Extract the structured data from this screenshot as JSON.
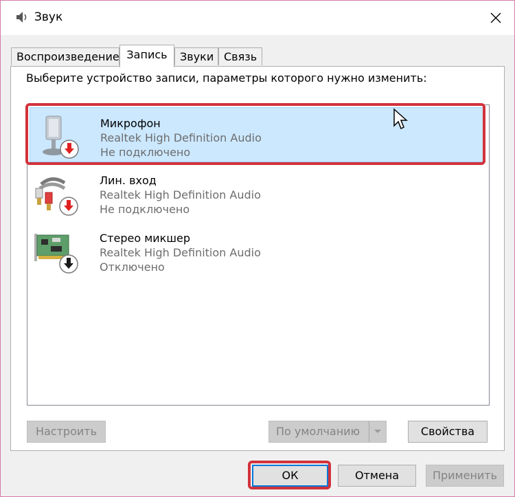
{
  "window": {
    "title": "Звук",
    "close_symbol": "✕"
  },
  "tabs": [
    {
      "label": "Воспроизведение"
    },
    {
      "label": "Запись"
    },
    {
      "label": "Звуки"
    },
    {
      "label": "Связь"
    }
  ],
  "active_tab": "Запись",
  "instruction": "Выберите устройство записи, параметры которого нужно изменить:",
  "devices": [
    {
      "name": "Микрофон",
      "driver": "Realtek High Definition Audio",
      "status": "Не подключено",
      "icon": "microphone-icon",
      "status_icon": "red-down-arrow-icon"
    },
    {
      "name": "Лин. вход",
      "driver": "Realtek High Definition Audio",
      "status": "Не подключено",
      "icon": "line-in-cable-icon",
      "status_icon": "red-down-arrow-icon"
    },
    {
      "name": "Стерео микшер",
      "driver": "Realtek High Definition Audio",
      "status": "Отключено",
      "icon": "sound-card-icon",
      "status_icon": "black-down-arrow-icon"
    }
  ],
  "buttons": {
    "configure": "Настроить",
    "default": "По умолчанию",
    "properties": "Свойства",
    "ok": "ОК",
    "cancel": "Отмена",
    "apply": "Применить"
  },
  "colors": {
    "selection": "#cce8ff",
    "highlight_annotation": "#d2323c",
    "focus_border": "#0078d7"
  }
}
